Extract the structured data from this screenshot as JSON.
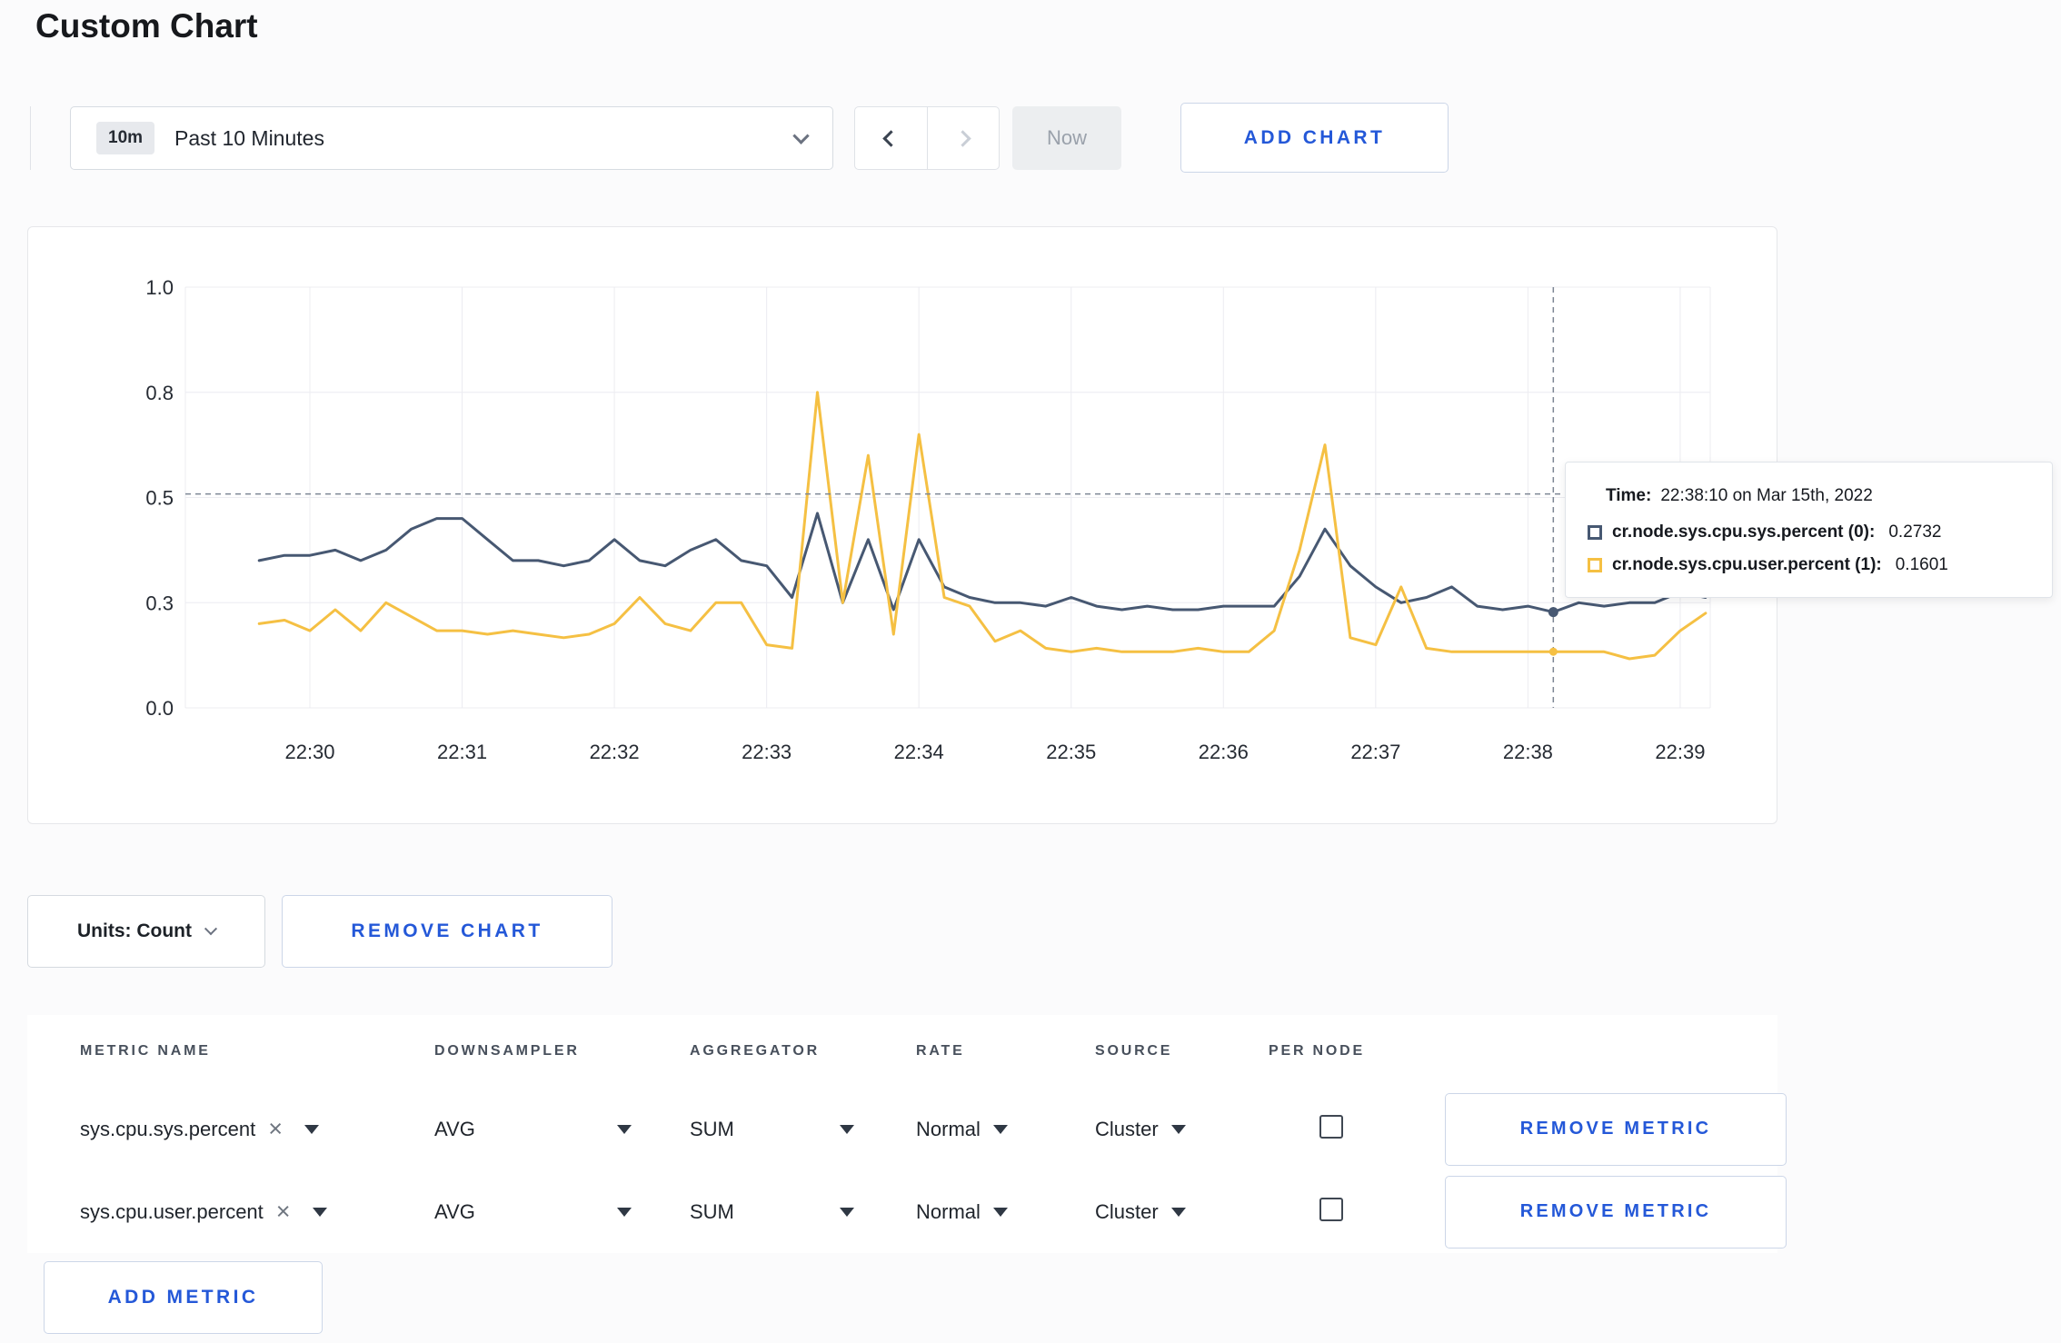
{
  "page": {
    "title": "Custom Chart"
  },
  "toolbar": {
    "time_badge": "10m",
    "time_range_label": "Past 10 Minutes",
    "now_label": "Now",
    "add_chart_label": "ADD CHART"
  },
  "chart_controls": {
    "units_label": "Units: Count",
    "remove_chart_label": "REMOVE CHART"
  },
  "tooltip": {
    "time_label": "Time:",
    "time_value": "22:38:10 on Mar 15th, 2022",
    "series": [
      {
        "label": "cr.node.sys.cpu.sys.percent (0):",
        "value": "0.2732",
        "color": "#475872"
      },
      {
        "label": "cr.node.sys.cpu.user.percent (1):",
        "value": "0.1601",
        "color": "#f5c043"
      }
    ]
  },
  "metrics_table": {
    "headers": [
      "METRIC NAME",
      "DOWNSAMPLER",
      "AGGREGATOR",
      "RATE",
      "SOURCE",
      "PER NODE"
    ],
    "rows": [
      {
        "metric": "sys.cpu.sys.percent",
        "downsampler": "AVG",
        "aggregator": "SUM",
        "rate": "Normal",
        "source": "Cluster",
        "per_node_checked": false,
        "remove_label": "REMOVE METRIC"
      },
      {
        "metric": "sys.cpu.user.percent",
        "downsampler": "AVG",
        "aggregator": "SUM",
        "rate": "Normal",
        "source": "Cluster",
        "per_node_checked": false,
        "remove_label": "REMOVE METRIC"
      }
    ],
    "add_metric_label": "ADD METRIC"
  },
  "colors": {
    "accent_blue": "#2458d8",
    "series_sys": "#475872",
    "series_user": "#f5c043"
  },
  "chart_data": {
    "type": "line",
    "title": "",
    "xlabel": "",
    "ylabel": "",
    "x_ticks": [
      "22:30",
      "22:31",
      "22:32",
      "22:33",
      "22:34",
      "22:35",
      "22:36",
      "22:37",
      "22:38",
      "22:39"
    ],
    "y_ticks": [
      0.0,
      0.3,
      0.5,
      0.8,
      1.0
    ],
    "ylim": [
      0,
      1
    ],
    "grid": true,
    "legend": "none",
    "interval_seconds": 10,
    "start_offset_seconds": -20,
    "series": [
      {
        "name": "cr.node.sys.cpu.sys.percent",
        "color": "#475872",
        "values": [
          0.38,
          0.39,
          0.39,
          0.4,
          0.38,
          0.4,
          0.44,
          0.46,
          0.46,
          0.42,
          0.38,
          0.38,
          0.37,
          0.38,
          0.42,
          0.38,
          0.37,
          0.4,
          0.42,
          0.38,
          0.37,
          0.31,
          0.47,
          0.3,
          0.42,
          0.28,
          0.42,
          0.33,
          0.31,
          0.3,
          0.3,
          0.29,
          0.31,
          0.29,
          0.28,
          0.29,
          0.28,
          0.28,
          0.29,
          0.29,
          0.29,
          0.35,
          0.44,
          0.37,
          0.33,
          0.3,
          0.31,
          0.33,
          0.29,
          0.28,
          0.29,
          0.2732,
          0.3,
          0.29,
          0.3,
          0.3,
          0.32,
          0.31
        ]
      },
      {
        "name": "cr.node.sys.cpu.user.percent",
        "color": "#f5c043",
        "values": [
          0.24,
          0.25,
          0.22,
          0.28,
          0.22,
          0.3,
          0.26,
          0.22,
          0.22,
          0.21,
          0.22,
          0.21,
          0.2,
          0.21,
          0.24,
          0.31,
          0.24,
          0.22,
          0.3,
          0.3,
          0.18,
          0.17,
          0.8,
          0.3,
          0.62,
          0.21,
          0.68,
          0.31,
          0.29,
          0.19,
          0.22,
          0.17,
          0.16,
          0.17,
          0.16,
          0.16,
          0.16,
          0.17,
          0.16,
          0.16,
          0.22,
          0.4,
          0.65,
          0.2,
          0.18,
          0.33,
          0.17,
          0.16,
          0.16,
          0.16,
          0.16,
          0.1601,
          0.16,
          0.16,
          0.14,
          0.15,
          0.22,
          0.27
        ]
      }
    ],
    "hover": {
      "index": 51,
      "time": "22:38:10 on Mar 15th, 2022",
      "hline_value": 0.51,
      "values": [
        0.2732,
        0.1601
      ]
    }
  }
}
